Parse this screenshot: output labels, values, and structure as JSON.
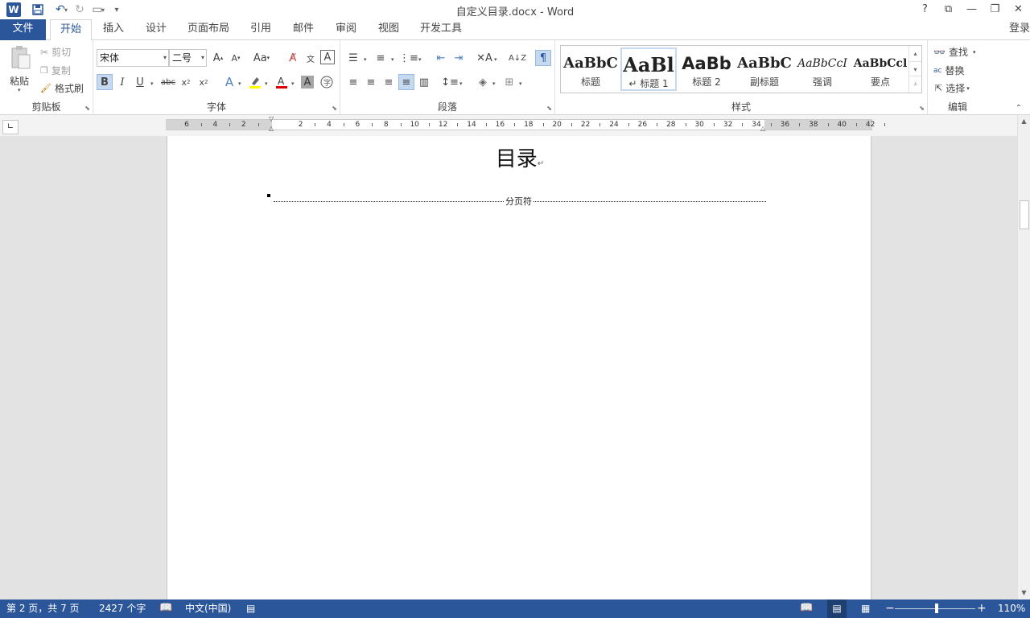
{
  "window": {
    "title": "自定义目录.docx - Word",
    "controls": [
      "?",
      "⧉",
      "—",
      "❐",
      "✕"
    ]
  },
  "tabs": {
    "file": "文件",
    "items": [
      "开始",
      "插入",
      "设计",
      "页面布局",
      "引用",
      "邮件",
      "审阅",
      "视图",
      "开发工具"
    ],
    "active": "开始",
    "signin": "登录"
  },
  "clipboard": {
    "label": "剪贴板",
    "paste": "粘贴",
    "cut": "剪切",
    "copy": "复制",
    "format_painter": "格式刷"
  },
  "font": {
    "label": "字体",
    "font_name": "宋体",
    "font_size": "二号"
  },
  "paragraph": {
    "label": "段落"
  },
  "styles": {
    "label": "样式",
    "items": [
      {
        "sample": "AaBbC",
        "name": "标题"
      },
      {
        "sample": "AaBl",
        "name": "↵ 标题 1"
      },
      {
        "sample": "AaBb",
        "name": "标题 2"
      },
      {
        "sample": "AaBbC",
        "name": "副标题"
      },
      {
        "sample": "AaBbCcI",
        "name": "强调"
      },
      {
        "sample": "AaBbCcl",
        "name": "要点"
      }
    ]
  },
  "editing": {
    "label": "编辑",
    "find": "查找",
    "replace": "替换",
    "select": "选择"
  },
  "document": {
    "heading": "目录",
    "page_break": "分页符"
  },
  "ruler": {
    "labels": [
      "6",
      "4",
      "2",
      "2",
      "4",
      "6",
      "8",
      "10",
      "12",
      "14",
      "16",
      "18",
      "20",
      "22",
      "24",
      "26",
      "28",
      "30",
      "32",
      "34",
      "36",
      "38",
      "40",
      "42"
    ]
  },
  "status": {
    "page": "第 2 页，共 7 页",
    "words": "2427 个字",
    "language": "中文(中国)",
    "zoom": "110%"
  },
  "colors": {
    "accent": "#2b579a",
    "page_bg": "#e3e3e3"
  }
}
